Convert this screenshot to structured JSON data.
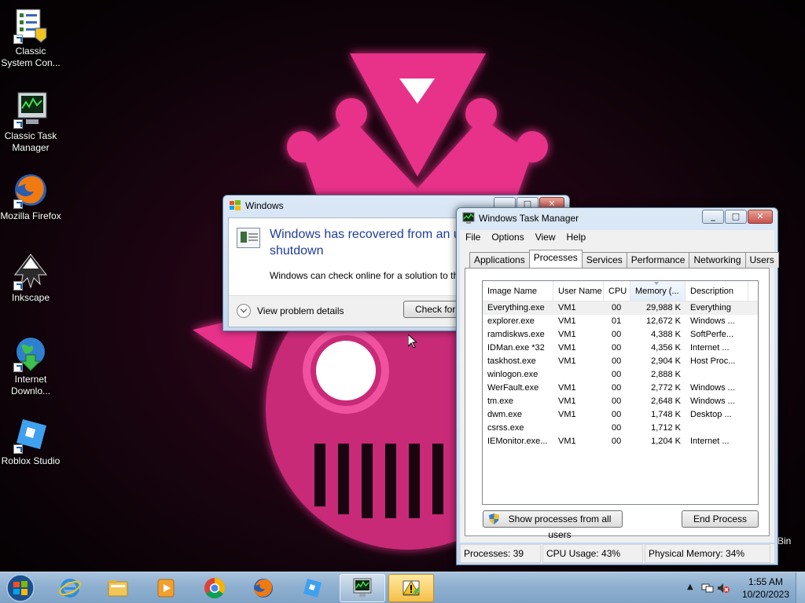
{
  "desktop": {
    "icons": [
      {
        "label": "Classic System Con...",
        "icon": "control-panel-icon"
      },
      {
        "label": "Classic Task Manager",
        "icon": "task-manager-icon"
      },
      {
        "label": "Mozilla Firefox",
        "icon": "firefox-icon"
      },
      {
        "label": "Inkscape",
        "icon": "inkscape-icon"
      },
      {
        "label": "Internet Downlo...",
        "icon": "internet-download-manager-icon"
      },
      {
        "label": "Roblox Studio",
        "icon": "roblox-studio-icon"
      }
    ],
    "partial_label": "Bin"
  },
  "error_dialog": {
    "title": "Windows",
    "headline": "Windows has recovered from an u... shutdown",
    "headline_line1": "Windows has recovered from an u",
    "headline_line2": "shutdown",
    "detail": "Windows can check online for a solution to th",
    "expand_label": "View problem details",
    "check_button": "Check for s"
  },
  "task_manager": {
    "title": "Windows Task Manager",
    "menu": [
      "File",
      "Options",
      "View",
      "Help"
    ],
    "tabs": [
      "Applications",
      "Processes",
      "Services",
      "Performance",
      "Networking",
      "Users"
    ],
    "active_tab": "Processes",
    "columns": [
      "Image Name",
      "User Name",
      "CPU",
      "Memory (...",
      "Description"
    ],
    "rows": [
      {
        "image": "Everything.exe",
        "user": "VM1",
        "cpu": "00",
        "memory": "29,988 K",
        "desc": "Everything"
      },
      {
        "image": "explorer.exe",
        "user": "VM1",
        "cpu": "01",
        "memory": "12,672 K",
        "desc": "Windows ..."
      },
      {
        "image": "ramdiskws.exe",
        "user": "VM1",
        "cpu": "00",
        "memory": "4,388 K",
        "desc": "SoftPerfe..."
      },
      {
        "image": "IDMan.exe *32",
        "user": "VM1",
        "cpu": "00",
        "memory": "4,356 K",
        "desc": "Internet ..."
      },
      {
        "image": "taskhost.exe",
        "user": "VM1",
        "cpu": "00",
        "memory": "2,904 K",
        "desc": "Host Proc..."
      },
      {
        "image": "winlogon.exe",
        "user": "",
        "cpu": "00",
        "memory": "2,888 K",
        "desc": ""
      },
      {
        "image": "WerFault.exe",
        "user": "VM1",
        "cpu": "00",
        "memory": "2,772 K",
        "desc": "Windows ..."
      },
      {
        "image": "tm.exe",
        "user": "VM1",
        "cpu": "00",
        "memory": "2,648 K",
        "desc": "Windows ..."
      },
      {
        "image": "dwm.exe",
        "user": "VM1",
        "cpu": "00",
        "memory": "1,748 K",
        "desc": "Desktop ..."
      },
      {
        "image": "csrss.exe",
        "user": "",
        "cpu": "00",
        "memory": "1,712 K",
        "desc": ""
      },
      {
        "image": "IEMonitor.exe...",
        "user": "VM1",
        "cpu": "00",
        "memory": "1,204 K",
        "desc": "Internet ..."
      }
    ],
    "show_all_button": "Show processes from all users",
    "end_process_button": "End Process",
    "status": {
      "processes": "Processes: 39",
      "cpu": "CPU Usage: 43%",
      "memory": "Physical Memory: 34%"
    }
  },
  "taskbar": {
    "pinned": [
      {
        "name": "internet-explorer",
        "icon": "internet-explorer-icon"
      },
      {
        "name": "file-explorer",
        "icon": "folder-icon"
      },
      {
        "name": "media-player",
        "icon": "media-player-icon"
      },
      {
        "name": "chrome",
        "icon": "chrome-icon"
      },
      {
        "name": "firefox",
        "icon": "firefox-icon"
      },
      {
        "name": "roblox-studio",
        "icon": "roblox-studio-icon"
      },
      {
        "name": "task-manager",
        "icon": "task-manager-icon"
      },
      {
        "name": "action-center",
        "icon": "warning-icon"
      }
    ],
    "clock": {
      "time": "1:55 AM",
      "date": "10/20/2023"
    }
  },
  "colors": {
    "accent_pink": "#e8308a",
    "dialog_headline": "#1e3d9c",
    "taskbar": "#8fb0d0"
  }
}
